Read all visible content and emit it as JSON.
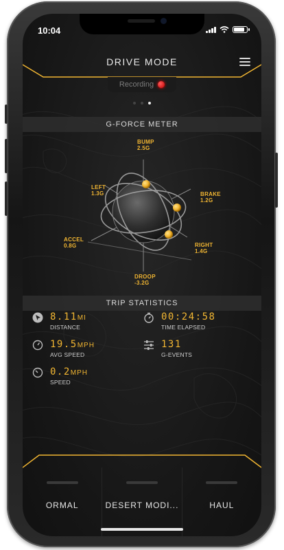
{
  "status_bar": {
    "time": "10:04"
  },
  "header": {
    "title": "DRIVE MODE"
  },
  "recording": {
    "label": "Recording"
  },
  "gforce": {
    "title": "G-FORCE METER",
    "labels": {
      "bump": {
        "name": "BUMP",
        "value": "2.5G"
      },
      "left": {
        "name": "LEFT",
        "value": "1.3G"
      },
      "brake": {
        "name": "BRAKE",
        "value": "1.2G"
      },
      "accel": {
        "name": "ACCEL",
        "value": "0.8G"
      },
      "right": {
        "name": "RIGHT",
        "value": "1.4G"
      },
      "droop": {
        "name": "DROOP",
        "value": "-3.2G"
      }
    }
  },
  "trip": {
    "title": "TRIP STATISTICS",
    "distance": {
      "value": "8.11",
      "unit": "MI",
      "label": "DISTANCE"
    },
    "time_elapsed": {
      "value": "00:24:58",
      "label": "TIME ELAPSED"
    },
    "avg_speed": {
      "value": "19.5",
      "unit": "MPH",
      "label": "AVG SPEED"
    },
    "g_events": {
      "value": "131",
      "label": "G-EVENTS"
    },
    "speed": {
      "value": "0.2",
      "unit": "MPH",
      "label": "SPEED"
    }
  },
  "modes": [
    {
      "label": "ORMAL"
    },
    {
      "label": "DESERT MODI..."
    },
    {
      "label": "HAUL"
    }
  ],
  "colors": {
    "accent": "#f2b632",
    "background": "#161616",
    "recording": "#e00000"
  }
}
